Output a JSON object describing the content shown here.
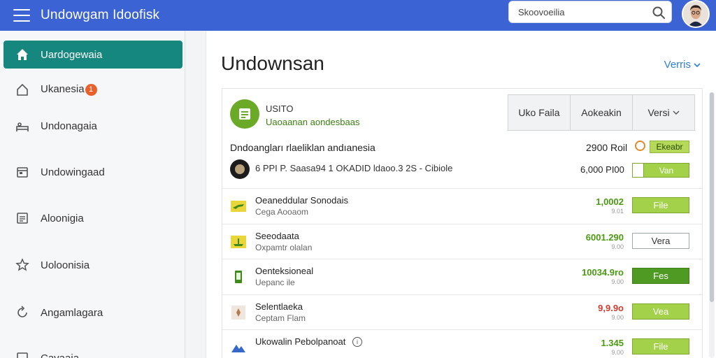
{
  "header": {
    "title": "Undowgam Idoofisk",
    "search_value": "Skoovoeilia"
  },
  "sidebar": {
    "items": [
      {
        "label": "Uardogewaia",
        "icon": "home-icon"
      },
      {
        "label": "Ukanesia",
        "icon": "house-outline-icon",
        "badge": "1"
      },
      {
        "label": "Undonagaia",
        "icon": "bed-icon"
      },
      {
        "label": "Undowingaad",
        "icon": "folder-icon"
      },
      {
        "label": "Aloonigia",
        "icon": "list-icon"
      },
      {
        "label": "Uoloonisia",
        "icon": "star-icon"
      },
      {
        "label": "Angamlagara",
        "icon": "refresh-icon"
      },
      {
        "label": "Cavaaia",
        "icon": "edit-icon"
      }
    ]
  },
  "main": {
    "title": "Undownsan",
    "view_link": "Verris",
    "card": {
      "title": "USITO",
      "subtitle": "Uaoaanan aondesbaas",
      "segments": [
        "Uko Faila",
        "Aokeakin",
        "Versi"
      ],
      "summary_text": "Dndoangları rlaeliklan andıanesia",
      "summary_amount": "2900 Roil",
      "summary_tag": "Ekeabr",
      "meta_text": "6 PPI P. Saasa94 1 OKADID ldaoo.3 2S - Cibiole",
      "meta_amount": "6,000 PI00",
      "meta_button": "Van",
      "rows": [
        {
          "icon": "plane-icon",
          "title": "Oeaneddular Sonodais",
          "sub": "Cega Aooaom",
          "amount": "1,0002",
          "amount_sub": "9.01",
          "amount_color": "#4a9a10",
          "button": "File",
          "btn_style": "green"
        },
        {
          "icon": "boat-icon",
          "title": "Seeodaata",
          "sub": "Oxpamtr olalan",
          "amount": "6001.290",
          "amount_sub": "9.00",
          "amount_color": "#4a9a10",
          "button": "Vera",
          "btn_style": "outline"
        },
        {
          "icon": "device-icon",
          "title": "Oenteksioneal",
          "sub": "Uepanc ile",
          "amount": "10034.9ro",
          "amount_sub": "9.00",
          "amount_color": "#4a9a10",
          "button": "Fes",
          "btn_style": "dark"
        },
        {
          "icon": "tag-icon",
          "title": "Selentlaeka",
          "sub": "Ceptam Flam",
          "amount": "9,9.9o",
          "amount_sub": "9.00",
          "amount_color": "#d23b2c",
          "button": "Vea",
          "btn_style": "green"
        },
        {
          "icon": "mountain-icon",
          "title": "Ukowalin Pebolpanoat",
          "sub": "",
          "amount": "1.345",
          "amount_sub": "9.00",
          "amount_color": "#4a9a10",
          "button": "File",
          "btn_style": "green"
        }
      ]
    }
  },
  "colors": {
    "topbar": "#3c63d4",
    "sidebar_active": "#15877e",
    "accent_green": "#a3d14a",
    "link_blue": "#2f7fd6"
  }
}
